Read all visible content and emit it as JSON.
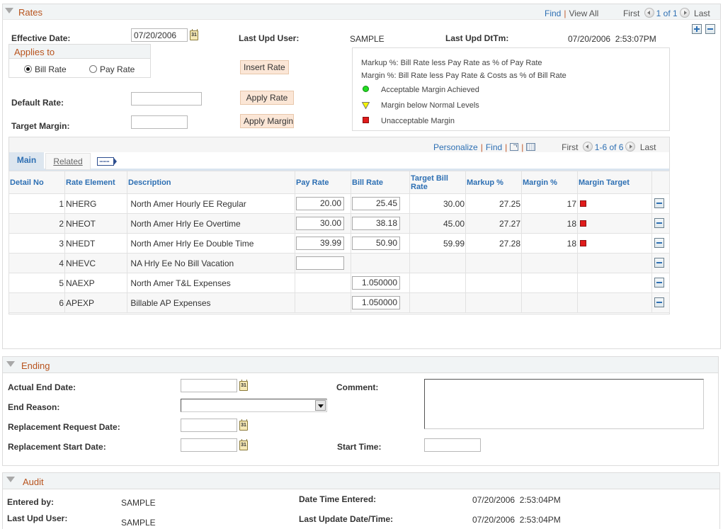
{
  "rates": {
    "title": "Rates",
    "nav": {
      "find": "Find",
      "view_all": "View All",
      "first": "First",
      "count": "1 of 1",
      "last": "Last"
    },
    "effective_date_label": "Effective Date:",
    "effective_date": "07/20/2006",
    "last_upd_user_label": "Last Upd User:",
    "last_upd_user": "SAMPLE",
    "last_upd_dttm_label": "Last Upd DtTm:",
    "last_upd_dttm": "07/20/2006  2:53:07PM",
    "applies_to": {
      "title": "Applies to",
      "options": [
        "Bill Rate",
        "Pay Rate"
      ],
      "selected": "Bill Rate"
    },
    "insert_rate": "Insert Rate",
    "apply_rate": "Apply Rate",
    "apply_margin": "Apply Margin",
    "default_rate_label": "Default Rate:",
    "default_rate": "",
    "target_margin_label": "Target Margin:",
    "target_margin": "",
    "legend": {
      "markup_note": "Markup %: Bill Rate less Pay Rate as % of Pay Rate",
      "margin_note": "Margin %: Bill Rate less Pay Rate & Costs as % of Bill Rate",
      "items": [
        {
          "icon": "green-circle-icon",
          "label": "Acceptable Margin Achieved",
          "color": "#22dd22"
        },
        {
          "icon": "yellow-triangle-icon",
          "label": "Margin below Normal Levels",
          "color": "#f5f500"
        },
        {
          "icon": "red-square-icon",
          "label": "Unacceptable Margin",
          "color": "#e01b1b"
        }
      ]
    },
    "grid": {
      "toolbar": {
        "personalize": "Personalize",
        "find": "Find",
        "first": "First",
        "count": "1-6 of 6",
        "last": "Last"
      },
      "tabs": [
        {
          "label": "Main",
          "active": true
        },
        {
          "label": "Related",
          "active": false
        }
      ],
      "columns": [
        "Detail No",
        "Rate Element",
        "Description",
        "Pay Rate",
        "Bill Rate",
        "Target Bill Rate",
        "Markup %",
        "Margin %",
        "Margin Target"
      ],
      "rows": [
        {
          "detail_no": "1",
          "rate_element": "NHERG",
          "description": "North Amer Hourly EE Regular",
          "pay_rate": "20.00",
          "bill_rate": "25.45",
          "target_bill_rate": "30.00",
          "markup": "27.25",
          "margin": "17",
          "margin_target": "red"
        },
        {
          "detail_no": "2",
          "rate_element": "NHEOT",
          "description": "North Amer Hrly Ee Overtime",
          "pay_rate": "30.00",
          "bill_rate": "38.18",
          "target_bill_rate": "45.00",
          "markup": "27.27",
          "margin": "18",
          "margin_target": "red"
        },
        {
          "detail_no": "3",
          "rate_element": "NHEDT",
          "description": "North Amer Hrly Ee Double Time",
          "pay_rate": "39.99",
          "bill_rate": "50.90",
          "target_bill_rate": "59.99",
          "markup": "27.28",
          "margin": "18",
          "margin_target": "red"
        },
        {
          "detail_no": "4",
          "rate_element": "NHEVC",
          "description": "NA Hrly Ee No Bill Vacation",
          "pay_rate": "",
          "bill_rate": null,
          "target_bill_rate": "",
          "markup": "",
          "margin": "",
          "margin_target": ""
        },
        {
          "detail_no": "5",
          "rate_element": "NAEXP",
          "description": "North Amer T&L Expenses",
          "pay_rate": null,
          "bill_rate": "1.050000",
          "target_bill_rate": "",
          "markup": "",
          "margin": "",
          "margin_target": ""
        },
        {
          "detail_no": "6",
          "rate_element": "APEXP",
          "description": "Billable AP Expenses",
          "pay_rate": null,
          "bill_rate": "1.050000",
          "target_bill_rate": "",
          "markup": "",
          "margin": "",
          "margin_target": ""
        }
      ]
    }
  },
  "ending": {
    "title": "Ending",
    "actual_end_date_label": "Actual End Date:",
    "actual_end_date": "",
    "end_reason_label": "End Reason:",
    "end_reason": "",
    "replacement_request_date_label": "Replacement Request Date:",
    "replacement_request_date": "",
    "replacement_start_date_label": "Replacement Start Date:",
    "replacement_start_date": "",
    "comment_label": "Comment:",
    "comment": "",
    "start_time_label": "Start Time:",
    "start_time": ""
  },
  "audit": {
    "title": "Audit",
    "entered_by_label": "Entered by:",
    "entered_by": "SAMPLE",
    "last_upd_user_label": "Last Upd User:",
    "last_upd_user": "SAMPLE",
    "date_time_entered_label": "Date Time Entered:",
    "date_time_entered": "07/20/2006  2:53:04PM",
    "last_update_label": "Last Update Date/Time:",
    "last_update": "07/20/2006  2:53:04PM"
  }
}
